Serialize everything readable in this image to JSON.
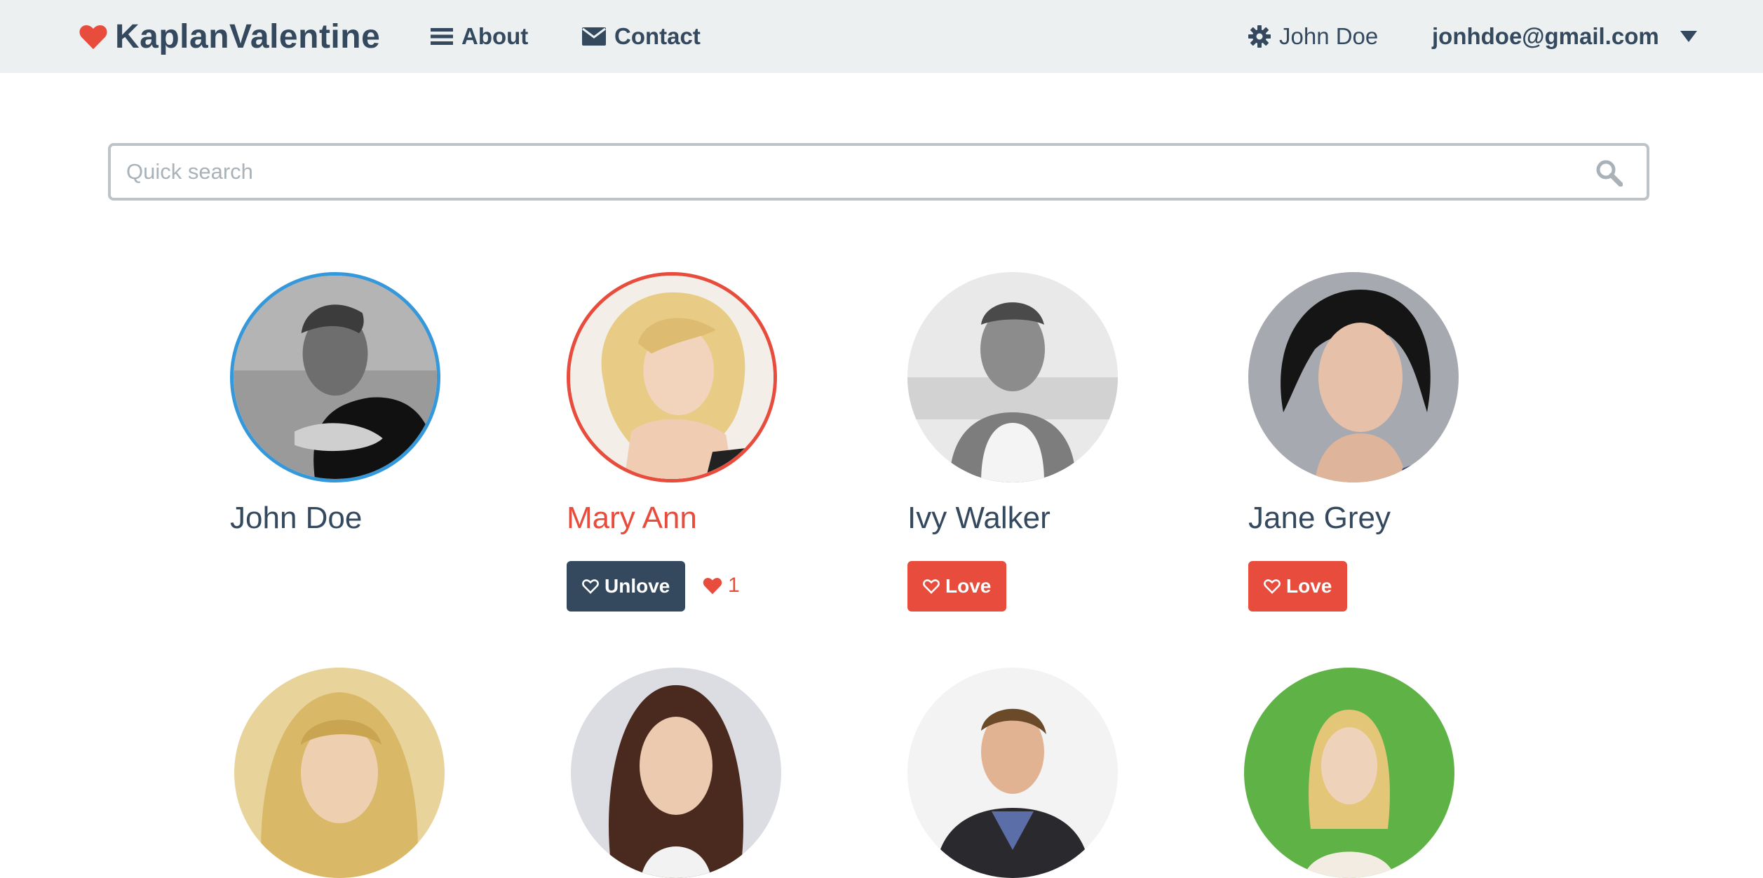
{
  "navbar": {
    "brand": "KaplanValentine",
    "links": {
      "about": "About",
      "contact": "Contact"
    },
    "user_name": "John Doe",
    "user_email": "jonhdoe@gmail.com"
  },
  "search": {
    "placeholder": "Quick search",
    "value": ""
  },
  "profiles": [
    {
      "name": "John Doe",
      "ring": "blue"
    },
    {
      "name": "Mary Ann",
      "ring": "red",
      "button": "Unlove",
      "love_count": "1"
    },
    {
      "name": "Ivy Walker",
      "button": "Love"
    },
    {
      "name": "Jane Grey",
      "button": "Love"
    },
    {
      "name": ""
    },
    {
      "name": ""
    },
    {
      "name": ""
    },
    {
      "name": ""
    }
  ],
  "colors": {
    "accent_red": "#e74c3c",
    "dark": "#34495e",
    "blue": "#3498db",
    "navbar": "#ecf0f1"
  }
}
